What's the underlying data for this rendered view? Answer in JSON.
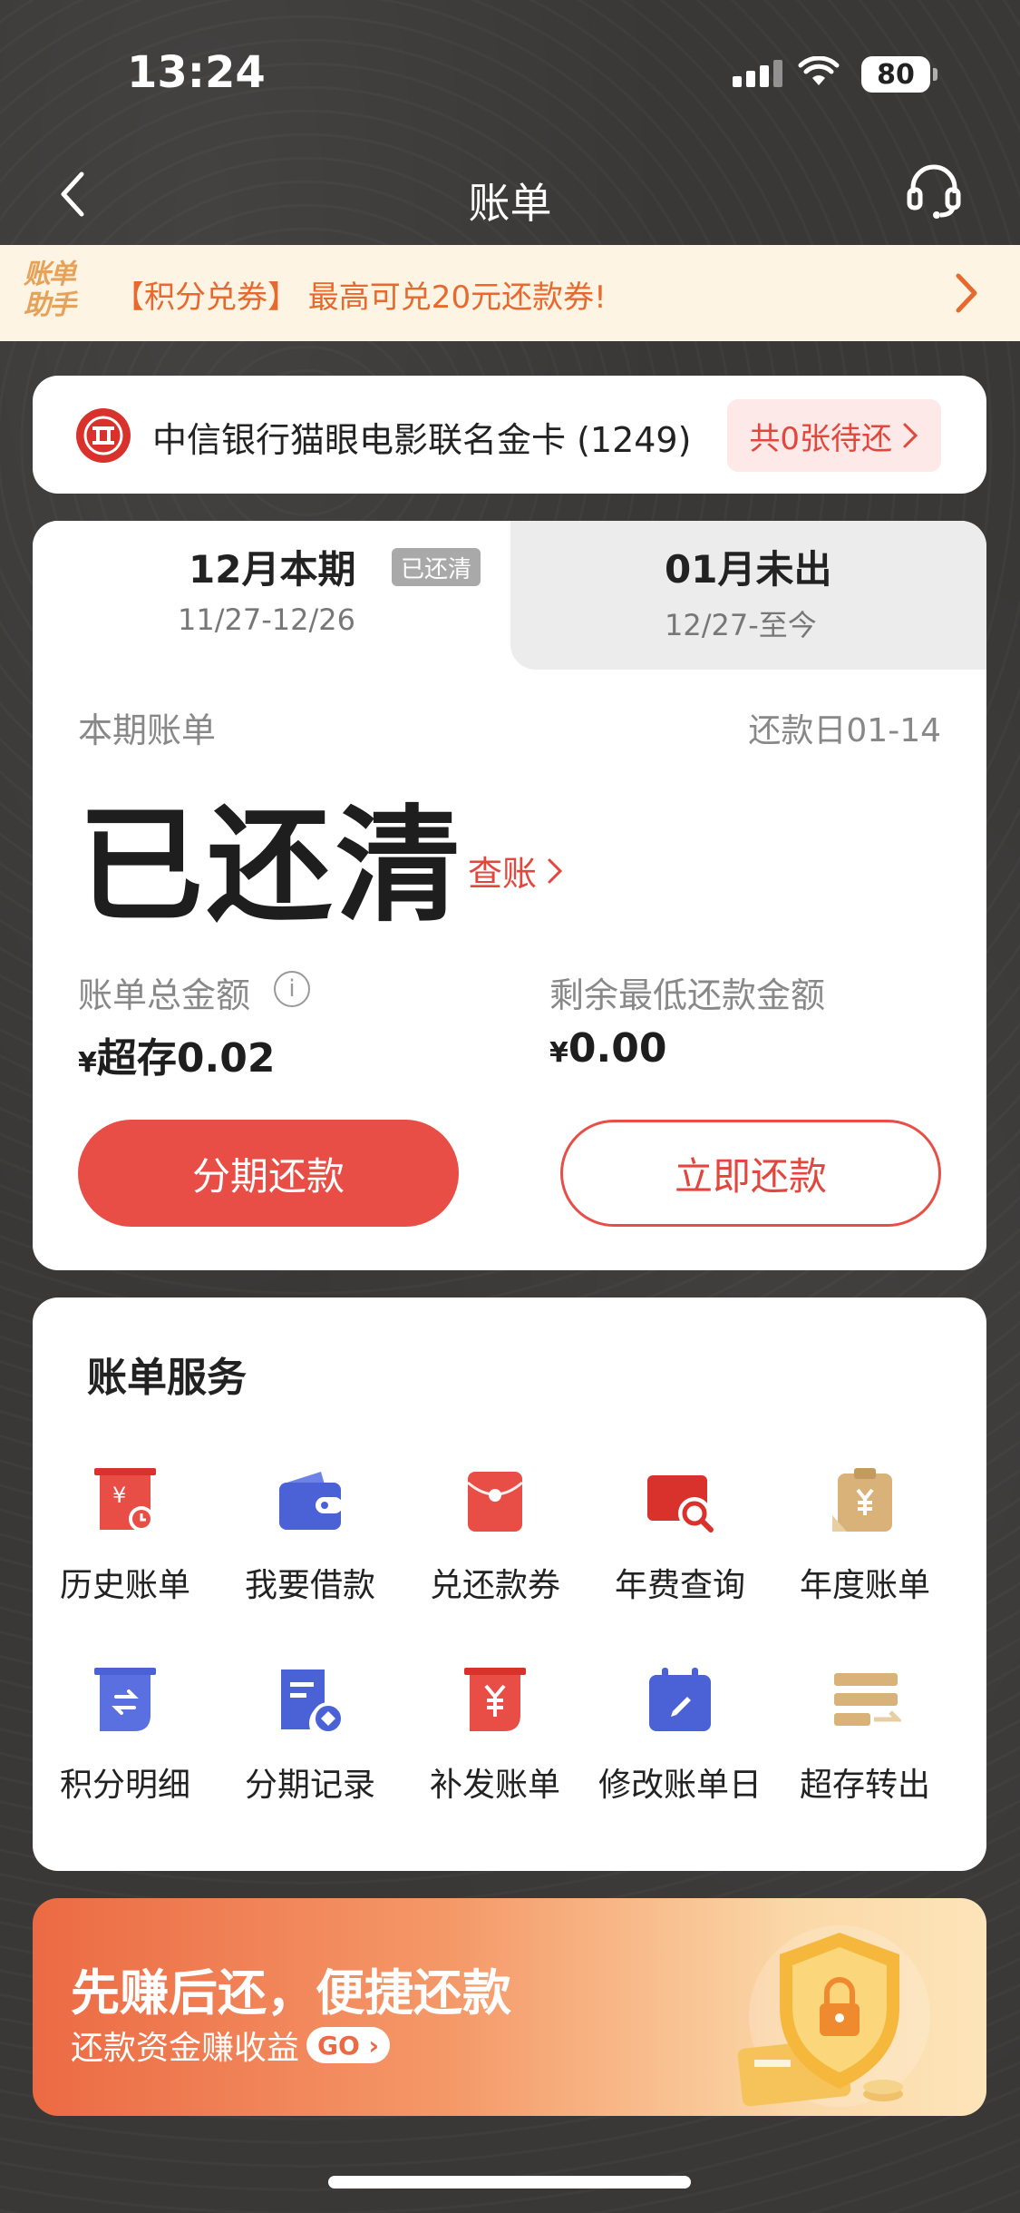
{
  "status_bar": {
    "time": "13:24",
    "battery": "80"
  },
  "nav": {
    "title": "账单"
  },
  "promo": {
    "logo": "账单助手",
    "text": "【积分兑券】 最高可兑20元还款券!"
  },
  "card": {
    "name": "中信银行猫眼电影联名金卡 (1249)",
    "pending": "共0张待还"
  },
  "bill": {
    "tab_current": {
      "title": "12月本期",
      "badge": "已还清",
      "range": "11/27-12/26"
    },
    "tab_next": {
      "title": "01月未出",
      "range": "12/27-至今"
    },
    "section_label": "本期账单",
    "due_date": "还款日01-14",
    "status": "已还清",
    "check_link": "查账",
    "total_label": "账单总金额",
    "total_yen": "¥",
    "total_value": "超存0.02",
    "min_label": "剩余最低还款金额",
    "min_yen": "¥",
    "min_value": "0.00",
    "installment_btn": "分期还款",
    "repay_btn": "立即还款"
  },
  "services": {
    "title": "账单服务",
    "items": [
      {
        "label": "历史账单",
        "icon": "history-bill-icon"
      },
      {
        "label": "我要借款",
        "icon": "wallet-icon"
      },
      {
        "label": "兑还款券",
        "icon": "red-envelope-icon"
      },
      {
        "label": "年费查询",
        "icon": "card-search-icon"
      },
      {
        "label": "年度账单",
        "icon": "clipboard-yen-icon"
      },
      {
        "label": "积分明细",
        "icon": "points-detail-icon"
      },
      {
        "label": "分期记录",
        "icon": "installment-record-icon"
      },
      {
        "label": "补发账单",
        "icon": "reissue-bill-icon"
      },
      {
        "label": "修改账单日",
        "icon": "calendar-edit-icon"
      },
      {
        "label": "超存转出",
        "icon": "transfer-out-icon"
      }
    ]
  },
  "bottom_promo": {
    "title": "先赚后还，便捷还款",
    "subtitle": "还款资金赚收益",
    "go": "GO"
  },
  "colors": {
    "accent_red": "#e94e46",
    "promo_orange": "#e8692e",
    "blue": "#4a62d6",
    "gold": "#d9b27a"
  }
}
